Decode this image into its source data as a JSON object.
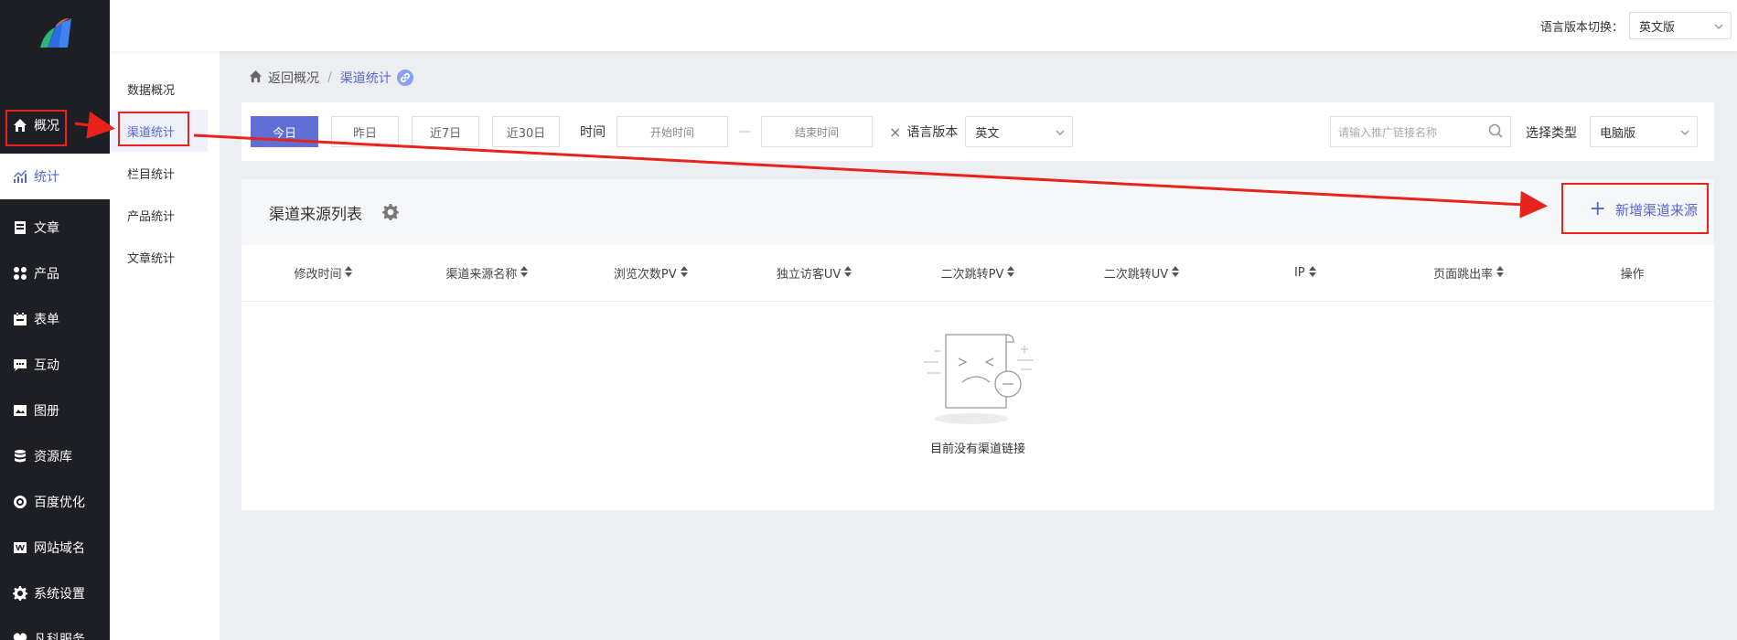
{
  "sidebar": {
    "items": [
      {
        "label": "概况",
        "icon": "home-icon"
      },
      {
        "label": "统计",
        "icon": "chart-icon"
      },
      {
        "label": "文章",
        "icon": "document-icon"
      },
      {
        "label": "产品",
        "icon": "grid-icon"
      },
      {
        "label": "表单",
        "icon": "calendar-icon"
      },
      {
        "label": "互动",
        "icon": "chat-icon"
      },
      {
        "label": "图册",
        "icon": "image-icon"
      },
      {
        "label": "资源库",
        "icon": "database-icon"
      },
      {
        "label": "百度优化",
        "icon": "target-icon"
      },
      {
        "label": "网站域名",
        "icon": "w-icon"
      },
      {
        "label": "系统设置",
        "icon": "gear-icon"
      },
      {
        "label": "凡科服务",
        "icon": "heart-icon"
      }
    ]
  },
  "subnav": {
    "items": [
      {
        "label": "数据概况"
      },
      {
        "label": "渠道统计"
      },
      {
        "label": "栏目统计"
      },
      {
        "label": "产品统计"
      },
      {
        "label": "文章统计"
      }
    ]
  },
  "topbar": {
    "lang_label": "语言版本切换：",
    "lang_value": "英文版"
  },
  "breadcrumb": {
    "back": "返回概况",
    "sep": "/",
    "current": "渠道统计"
  },
  "filters": {
    "tabs": [
      "今日",
      "昨日",
      "近7日",
      "近30日"
    ],
    "time_label": "时间",
    "start_placeholder": "开始时间",
    "dash": "—",
    "end_placeholder": "结束时间",
    "clear": "×",
    "lang_label": "语言版本",
    "lang_value": "英文",
    "search_placeholder": "请输入推广链接名称",
    "type_label": "选择类型",
    "type_value": "电脑版"
  },
  "card": {
    "title": "渠道来源列表",
    "add_label": "新增渠道来源",
    "columns": [
      "修改时间",
      "渠道来源名称",
      "浏览次数PV",
      "独立访客UV",
      "二次跳转PV",
      "二次跳转UV",
      "IP",
      "页面跳出率",
      "操作"
    ],
    "empty_text": "目前没有渠道链接"
  },
  "colors": {
    "accent": "#5866d4",
    "sidebar_bg": "#1e1f24",
    "annotation": "#e8231c"
  }
}
